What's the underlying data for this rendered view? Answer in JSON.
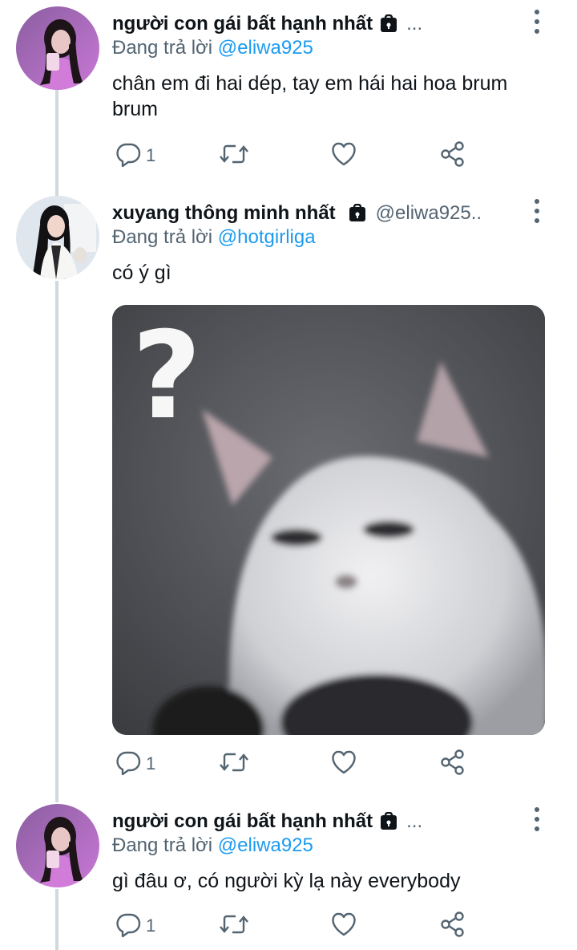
{
  "tweets": [
    {
      "author": "người con gái bất hạnh nhất",
      "handle": "...",
      "replying_prefix": "Đang trả lời ",
      "replying_to": "@eliwa925",
      "text": "chân em đi hai dép, tay em hái hai hoa brum brum",
      "reply_count": "1"
    },
    {
      "author": "xuyang thông minh nhất",
      "handle": "@eliwa925..",
      "replying_prefix": "Đang trả lời ",
      "replying_to": "@hotgirliga",
      "text": "có ý gì",
      "media": "cat-question-image",
      "reply_count": "1"
    },
    {
      "author": "người con gái bất hạnh nhất",
      "handle": "...",
      "replying_prefix": "Đang trả lời ",
      "replying_to": "@eliwa925",
      "text": "gì đâu ơ, có người kỳ lạ này everybody",
      "reply_count": "1"
    }
  ],
  "icons": [
    "reply-icon",
    "retweet-icon",
    "like-icon",
    "share-icon",
    "lock-icon",
    "more-options-icon"
  ],
  "colors": {
    "mention": "#1d9bf0",
    "secondary_text": "#536471",
    "primary_text": "#0f1419",
    "thread_line": "#cfd9de"
  }
}
